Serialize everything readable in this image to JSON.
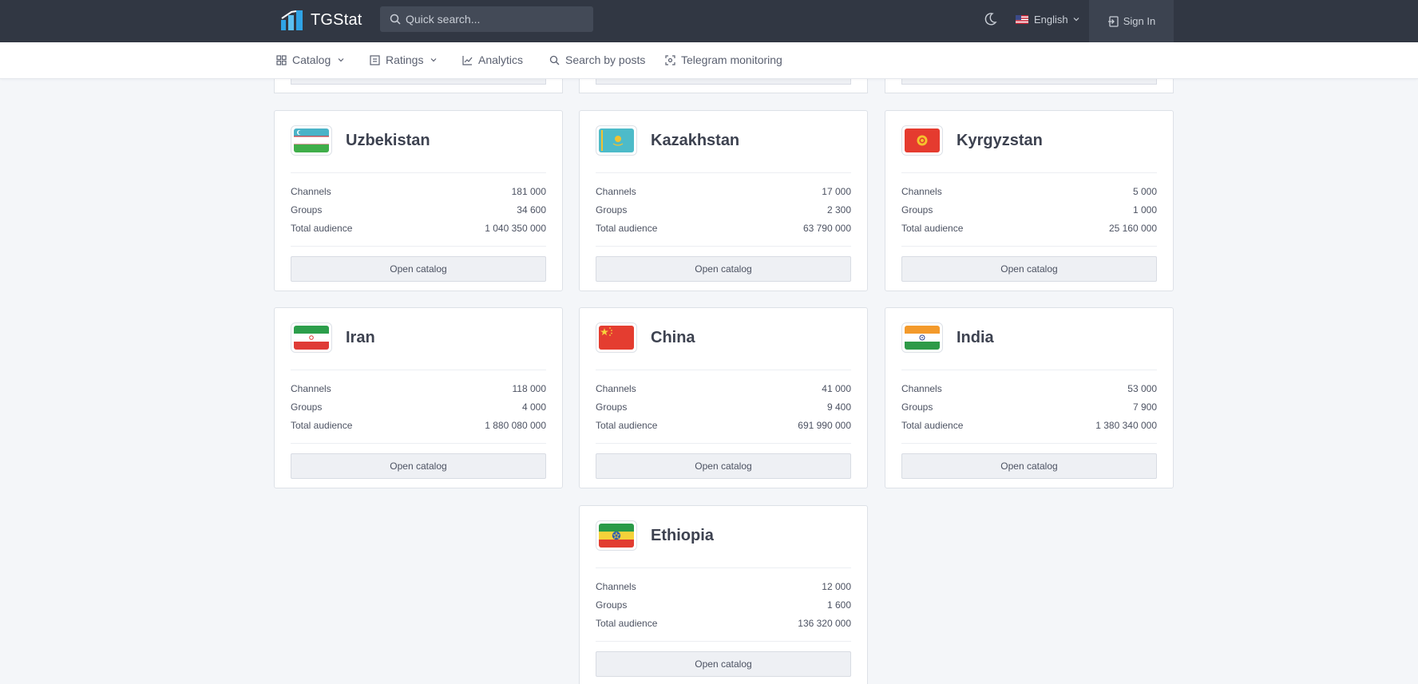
{
  "app": {
    "name": "TGStat"
  },
  "search": {
    "placeholder": "Quick search..."
  },
  "header": {
    "language": "English",
    "sign_in": "Sign In"
  },
  "nav": [
    {
      "label": "Catalog"
    },
    {
      "label": "Ratings"
    },
    {
      "label": "Analytics"
    },
    {
      "label": "Search by posts"
    },
    {
      "label": "Telegram monitoring"
    }
  ],
  "stat_labels": {
    "channels": "Channels",
    "groups": "Groups",
    "audience": "Total audience"
  },
  "button_label": "Open catalog",
  "countries": [
    {
      "name": "Uzbekistan",
      "channels": "181 000",
      "groups": "34 600",
      "audience": "1 040 350 000"
    },
    {
      "name": "Kazakhstan",
      "channels": "17 000",
      "groups": "2 300",
      "audience": "63 790 000"
    },
    {
      "name": "Kyrgyzstan",
      "channels": "5 000",
      "groups": "1 000",
      "audience": "25 160 000"
    },
    {
      "name": "Iran",
      "channels": "118 000",
      "groups": "4 000",
      "audience": "1 880 080 000"
    },
    {
      "name": "China",
      "channels": "41 000",
      "groups": "9 400",
      "audience": "691 990 000"
    },
    {
      "name": "India",
      "channels": "53 000",
      "groups": "7 900",
      "audience": "1 380 340 000"
    },
    {
      "name": "Ethiopia",
      "channels": "12 000",
      "groups": "1 600",
      "audience": "136 320 000"
    }
  ],
  "colors": {
    "topbar": "#313743",
    "accent": "#2fa3e6",
    "background": "#f4f6f9"
  }
}
